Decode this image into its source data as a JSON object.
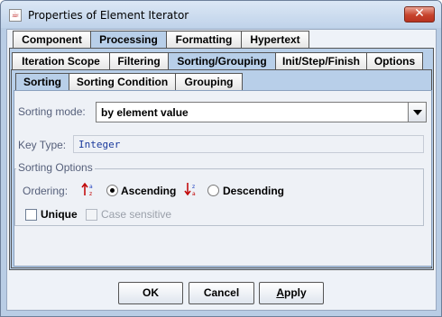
{
  "window": {
    "title": "Properties of Element Iterator",
    "close_symbol": "✕"
  },
  "tabs_level1": [
    "Component",
    "Processing",
    "Formatting",
    "Hypertext"
  ],
  "tabs_level1_active": "Processing",
  "tabs_level2": [
    "Iteration Scope",
    "Filtering",
    "Sorting/Grouping",
    "Init/Step/Finish",
    "Options"
  ],
  "tabs_level2_active": "Sorting/Grouping",
  "tabs_level3": [
    "Sorting",
    "Sorting Condition",
    "Grouping"
  ],
  "tabs_level3_active": "Sorting",
  "sorting": {
    "mode_label": "Sorting mode:",
    "mode_value": "by element value",
    "key_type_label": "Key Type:",
    "key_type_value": "Integer",
    "options_title": "Sorting Options",
    "ordering_label": "Ordering:",
    "ascending_label": "Ascending",
    "descending_label": "Descending",
    "ordering_selected": "Ascending",
    "unique_label": "Unique",
    "unique_checked": false,
    "case_sensitive_label": "Case sensitive",
    "case_sensitive_enabled": false,
    "icons": {
      "ascending": "sort-ascending-icon",
      "descending": "sort-descending-icon"
    }
  },
  "buttons": {
    "ok": "OK",
    "cancel": "Cancel",
    "apply_mnemonic": "A",
    "apply_rest": "pply"
  },
  "colors": {
    "title_bar": "#c9d9ee",
    "tab_active": "#b8cfe9",
    "close_button": "#c7432c",
    "key_type_text": "#1a3a9c",
    "sort_icon_red": "#c00000",
    "sort_icon_blue": "#2040c0"
  }
}
